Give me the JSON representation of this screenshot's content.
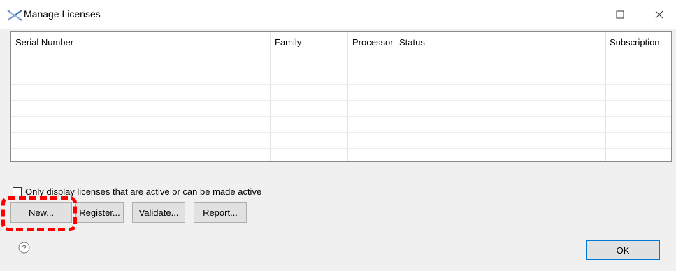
{
  "window": {
    "title": "Manage Licenses",
    "icon": "licenses-app-icon",
    "controls": [
      "minimize-icon",
      "maximize-icon",
      "close-icon"
    ]
  },
  "table": {
    "columns": [
      "Serial Number",
      "Family",
      "Processor",
      "Status",
      "Subscription"
    ],
    "rows": []
  },
  "filter": {
    "checkbox_label": "Only display licenses that are active or can be made active",
    "checked": false
  },
  "buttons": {
    "new": "New...",
    "register": "Register...",
    "validate": "Validate...",
    "report": "Report...",
    "ok": "OK"
  },
  "annotation": {
    "highlight_color": "#ff0000",
    "highlight_target": "New..."
  },
  "help": {
    "icon": "help-icon"
  }
}
